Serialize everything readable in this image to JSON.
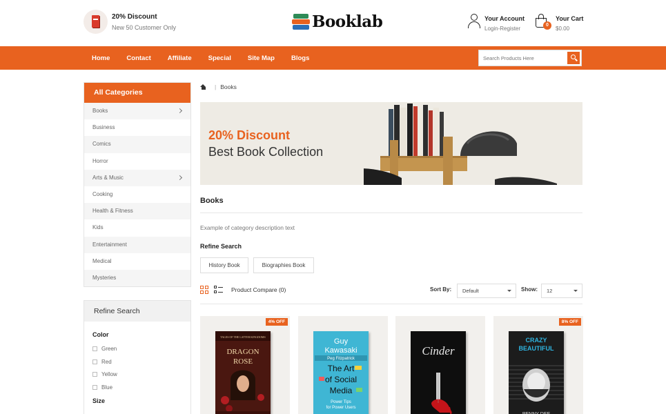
{
  "promo": {
    "title": "20% Discount",
    "subtitle": "New 50 Customer Only",
    "icon": "book-icon"
  },
  "logo": {
    "text": "Booklab",
    "icon": "books-stack-icon"
  },
  "account": {
    "title": "Your Account",
    "subtitle": "Login-Register",
    "icon": "user-icon"
  },
  "cart": {
    "title": "Your Cart",
    "total": "$0.00",
    "count": "0",
    "icon": "shopping-bag-icon"
  },
  "nav": {
    "items": [
      "Home",
      "Contact",
      "Affiliate",
      "Special",
      "Site Map",
      "Blogs"
    ],
    "search_placeholder": "Search Products Here",
    "accent": "#e8621f"
  },
  "sidebar": {
    "categories_title": "All Categories",
    "categories": [
      {
        "label": "Books",
        "has_children": true
      },
      {
        "label": "Business",
        "has_children": false
      },
      {
        "label": "Comics",
        "has_children": false
      },
      {
        "label": "Horror",
        "has_children": false
      },
      {
        "label": "Arts & Music",
        "has_children": true
      },
      {
        "label": "Cooking",
        "has_children": false
      },
      {
        "label": "Health & Fitness",
        "has_children": false
      },
      {
        "label": "Kids",
        "has_children": false
      },
      {
        "label": "Entertainment",
        "has_children": false
      },
      {
        "label": "Medical",
        "has_children": false
      },
      {
        "label": "Mysteries",
        "has_children": false
      }
    ],
    "refine_title": "Refine Search",
    "color_label": "Color",
    "colors": [
      "Green",
      "Red",
      "Yellow",
      "Blue"
    ],
    "size_label": "Size"
  },
  "breadcrumb": {
    "current": "Books"
  },
  "banner": {
    "line1": "20% Discount",
    "line2": "Best Book Collection"
  },
  "category": {
    "title": "Books",
    "description": "Example of category description text",
    "refine_title": "Refine Search",
    "chips": [
      "History Book",
      "Biographies Book"
    ]
  },
  "toolbar": {
    "compare": "Product Compare (0)",
    "sort_label": "Sort By:",
    "sort_value": "Default",
    "show_label": "Show:",
    "show_value": "12"
  },
  "products": [
    {
      "badge": "4% OFF",
      "cover_color": "#5a1a12"
    },
    {
      "badge": "",
      "cover_color": "#3db7d6"
    },
    {
      "badge": "",
      "cover_color": "#111111"
    },
    {
      "badge": "8% OFF",
      "cover_color": "#1d1d1d"
    }
  ]
}
